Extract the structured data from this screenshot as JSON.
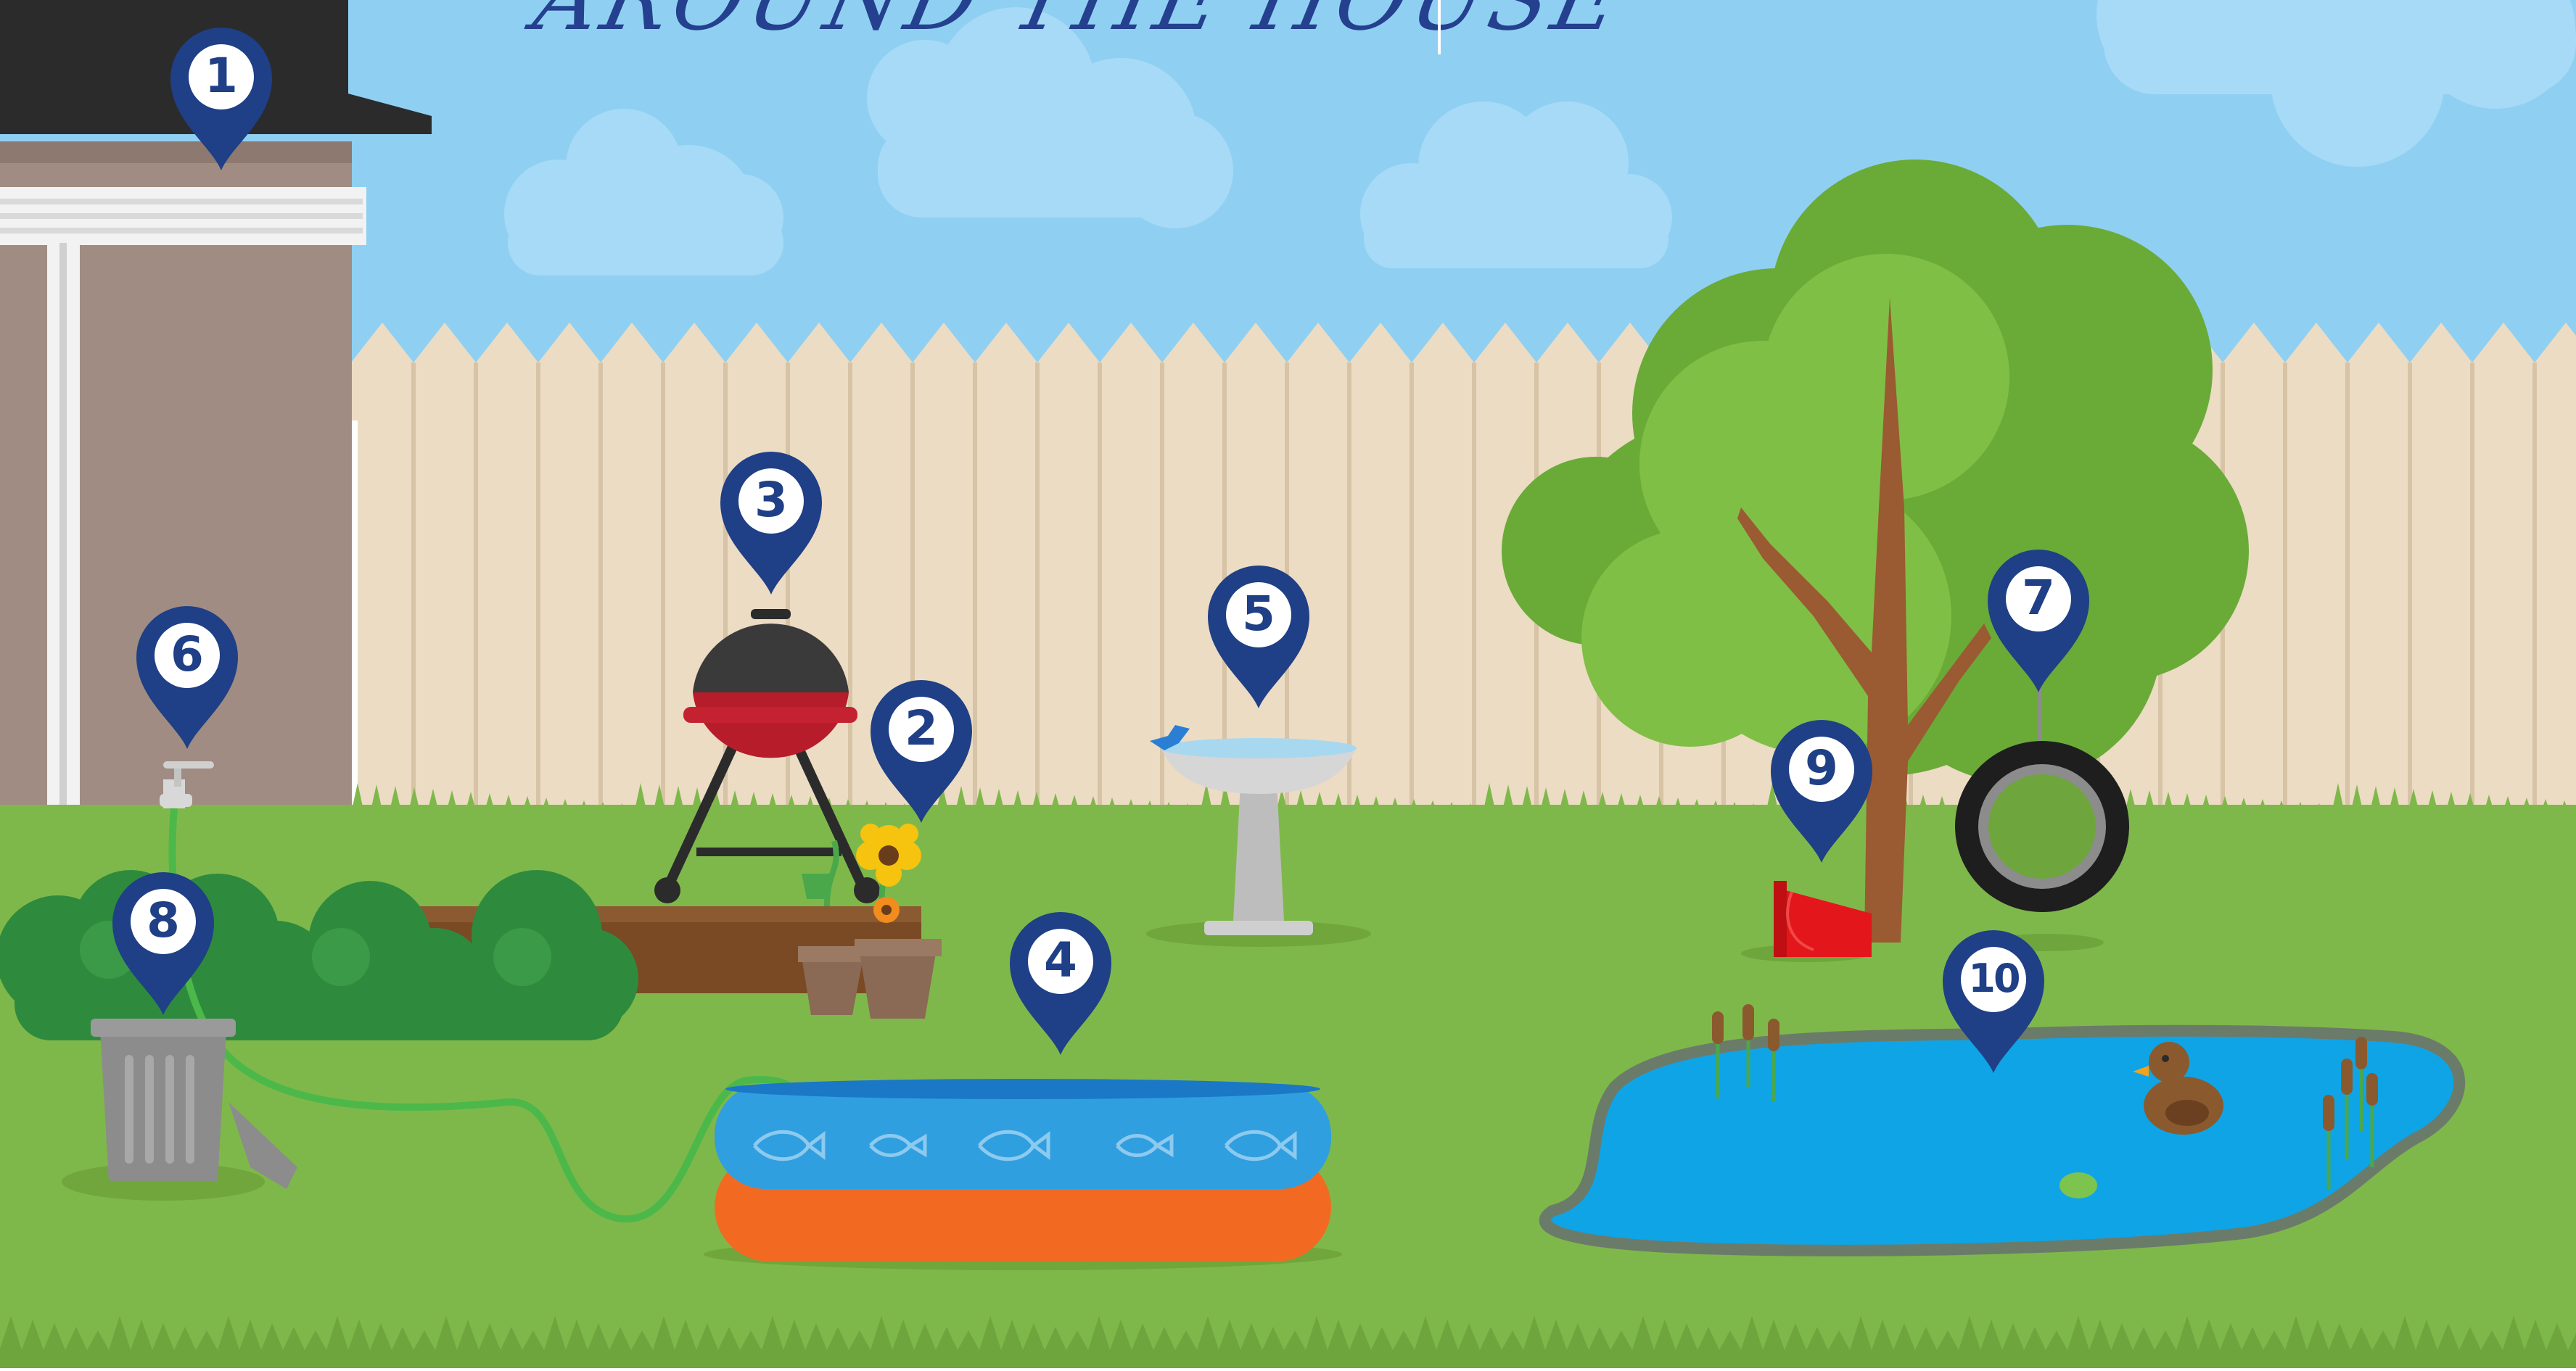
{
  "title": "AROUND THE HOUSE",
  "colors": {
    "sky": "#8fd0f2",
    "fence": "#ecdcc4",
    "grass": "#7fb84a",
    "pin": "#1f3f86",
    "pool_top": "#2f9fe0",
    "pool_bottom": "#f26a22",
    "pond": "#0fa4e6",
    "grill": "#b71c2b",
    "tree": "#6aab38"
  },
  "markers": [
    {
      "number": "1",
      "target": "roof-gutter"
    },
    {
      "number": "2",
      "target": "flower-pots"
    },
    {
      "number": "3",
      "target": "barbecue-grill"
    },
    {
      "number": "4",
      "target": "kiddie-pool"
    },
    {
      "number": "5",
      "target": "bird-bath"
    },
    {
      "number": "6",
      "target": "outdoor-faucet"
    },
    {
      "number": "7",
      "target": "tire-swing"
    },
    {
      "number": "8",
      "target": "trash-can"
    },
    {
      "number": "9",
      "target": "bucket"
    },
    {
      "number": "10",
      "target": "pond"
    }
  ]
}
